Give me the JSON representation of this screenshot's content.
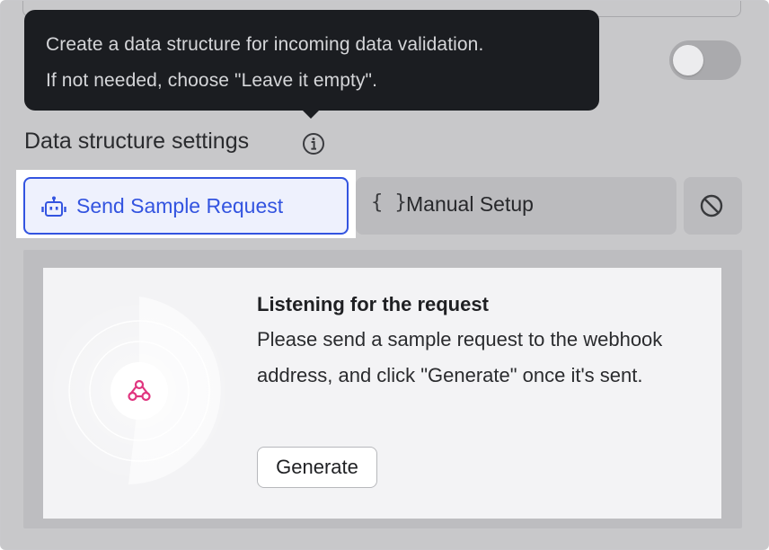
{
  "tooltip": {
    "line1": "Create a data structure for incoming data validation.",
    "line2": "If not needed, choose \"Leave it empty\"."
  },
  "section": {
    "title": "Data structure settings"
  },
  "modes": {
    "sample_label": "Send Sample Request",
    "manual_label": "Manual Setup",
    "manual_icon_text": "{ }"
  },
  "listening": {
    "title": "Listening for the request",
    "body": "Please send a sample request to the webhook address, and click \"Generate\" once it's sent.",
    "generate_label": "Generate"
  },
  "toggle": {
    "on": false
  },
  "colors": {
    "accent": "#3354e0",
    "webhook_icon": "#e0357f",
    "tooltip_bg": "#1b1d21"
  },
  "icons": {
    "info": "info-icon",
    "sample": "robot-icon",
    "manual": "braces-icon",
    "empty": "prohibit-icon",
    "listening": "webhook-icon"
  }
}
